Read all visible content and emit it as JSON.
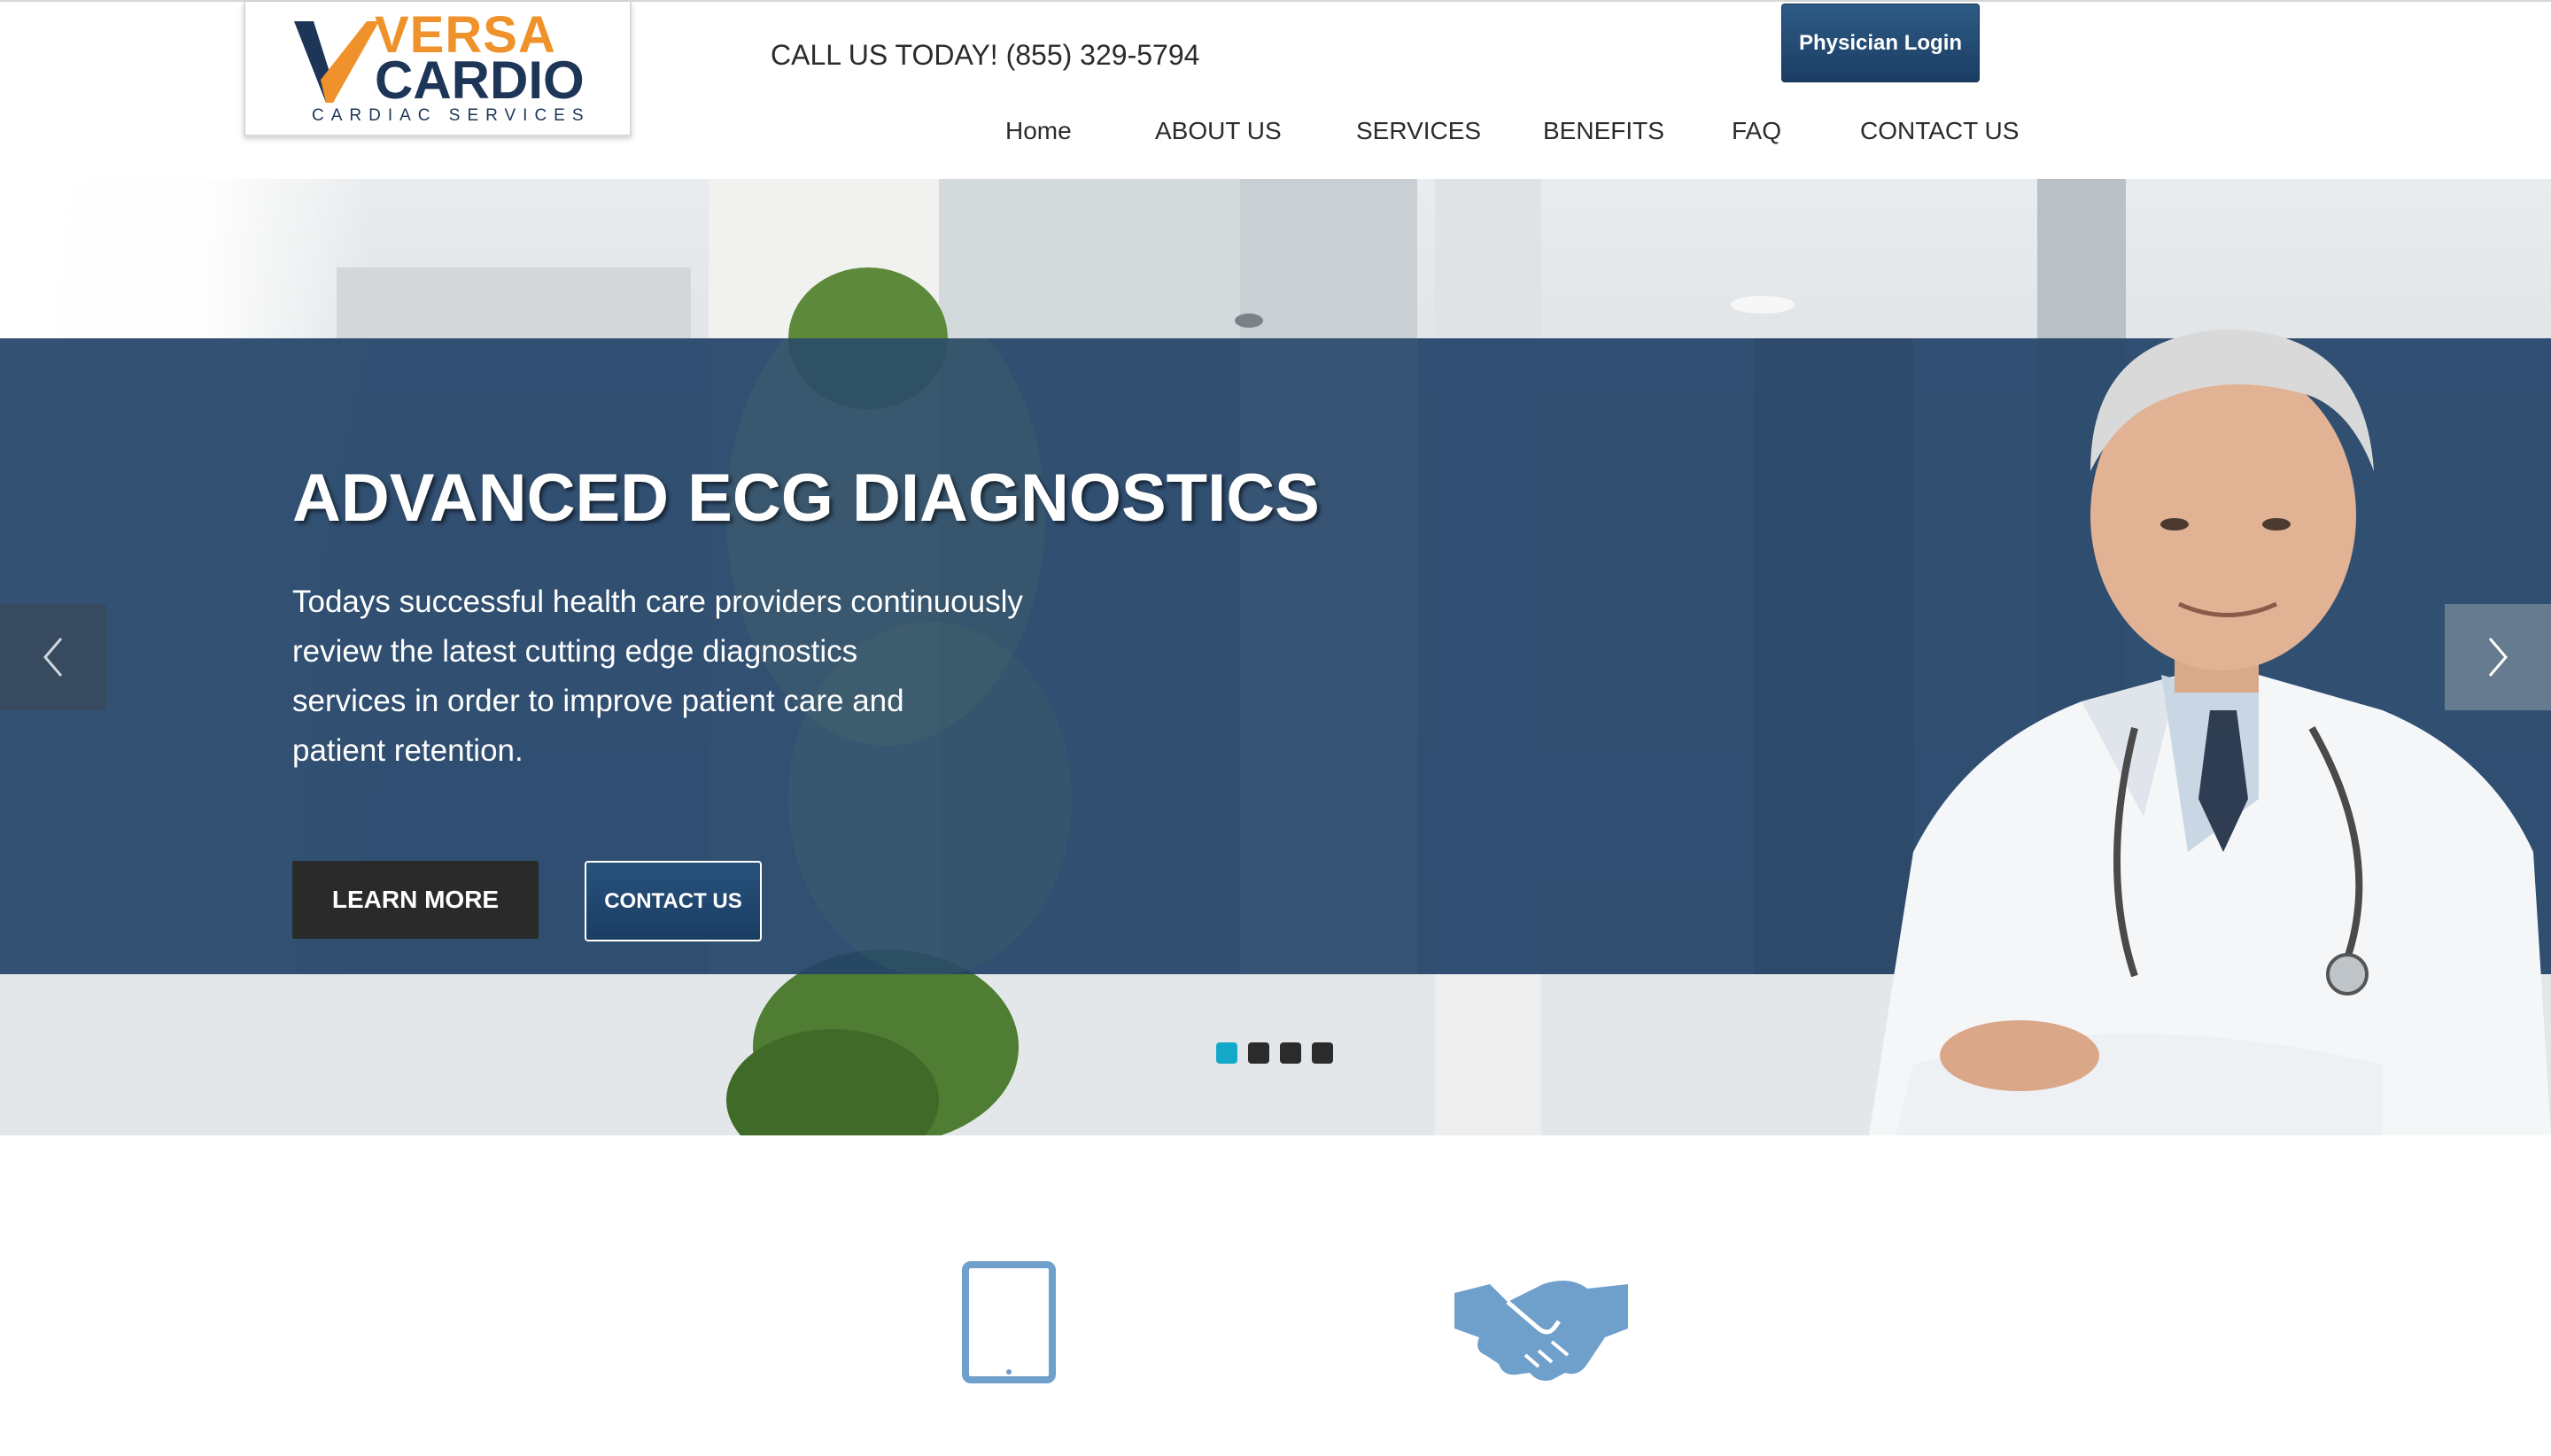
{
  "header": {
    "logo": {
      "line1": "VERSA",
      "line2": "CARDIO",
      "tagline": "CARDIAC SERVICES"
    },
    "call_us": "CALL US TODAY! (855) 329-5794",
    "login_label": "Physician Login"
  },
  "nav": {
    "items": [
      {
        "label": "Home"
      },
      {
        "label": "ABOUT US"
      },
      {
        "label": "SERVICES"
      },
      {
        "label": "BENEFITS"
      },
      {
        "label": "FAQ"
      },
      {
        "label": "CONTACT US"
      }
    ]
  },
  "hero": {
    "title": "ADVANCED ECG DIAGNOSTICS",
    "lines": [
      "Todays successful health care providers continuously",
      "review the latest cutting edge diagnostics",
      "services in order to improve patient care and",
      "patient retention."
    ],
    "learn_more": "LEARN MORE",
    "contact": "CONTACT US",
    "slides": {
      "count": 4,
      "active": 1
    }
  },
  "features": {
    "icons": [
      "tablet-icon",
      "handshake-icon"
    ]
  },
  "colors": {
    "brand_orange": "#f0922b",
    "brand_navy": "#1d3557",
    "hero_band": "#244468",
    "dot_active": "#14a9c9",
    "feature_icon": "#6f9fcb"
  }
}
